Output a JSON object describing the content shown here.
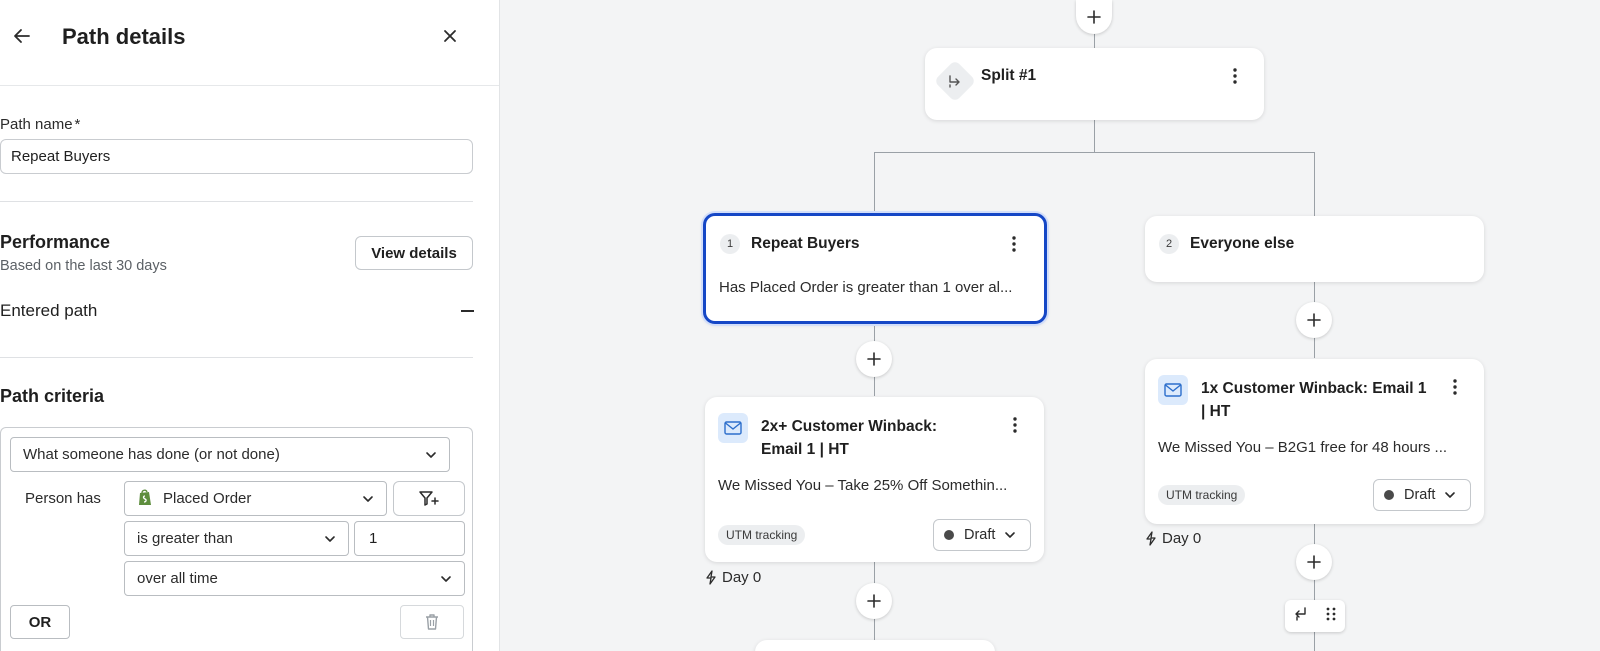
{
  "panel": {
    "title": "Path details",
    "path_name_label": "Path name",
    "required_mark": "*",
    "path_name_value": "Repeat Buyers",
    "performance_title": "Performance",
    "performance_sub": "Based on the last 30 days",
    "view_details_label": "View details",
    "entered_path_label": "Entered path",
    "criteria_title": "Path criteria",
    "criteria": {
      "condition_type": "What someone has done (or not done)",
      "person_has_label": "Person has",
      "metric": "Placed Order",
      "operator": "is greater than",
      "value": "1",
      "timeframe": "over all time",
      "or_label": "OR"
    }
  },
  "canvas": {
    "split": {
      "title": "Split #1"
    },
    "branch1": {
      "number": "1",
      "title": "Repeat Buyers",
      "description": "Has Placed Order is greater than 1 over al..."
    },
    "branch2": {
      "number": "2",
      "title": "Everyone else"
    },
    "email1": {
      "title_line1": "2x+ Customer Winback:",
      "title_line2": "Email 1 | HT",
      "subject": "We Missed You – Take 25% Off Somethin...",
      "tag": "UTM tracking",
      "status": "Draft",
      "day": "Day 0"
    },
    "email2": {
      "title_line1": "1x Customer Winback: Email 1",
      "title_line2": "| HT",
      "subject": "We Missed You – B2G1 free for 48 hours ...",
      "tag": "UTM tracking",
      "status": "Draft",
      "day": "Day 0"
    }
  },
  "colors": {
    "selected_border": "#1547c6",
    "canvas_bg": "#f3f4f5",
    "mail_icon_bg": "#dceafc"
  },
  "icons": [
    "back-arrow-icon",
    "close-icon",
    "split-icon",
    "kebab-icon",
    "mail-icon",
    "plus-icon",
    "chevron-down-icon",
    "shopify-icon",
    "filter-add-icon",
    "trash-icon",
    "lightning-icon",
    "branch-icon",
    "drag-handle-icon"
  ]
}
